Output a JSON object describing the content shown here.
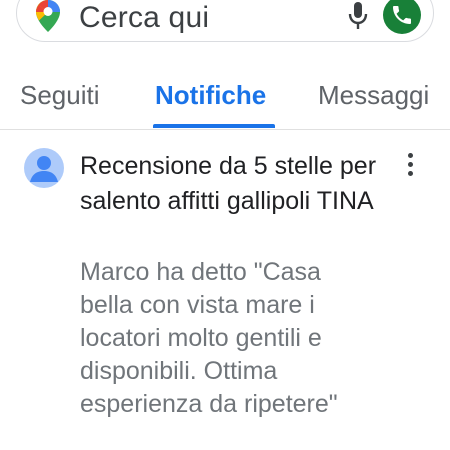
{
  "search": {
    "placeholder": "Cerca qui",
    "maps_icon": "google-maps-pin-icon",
    "mic_icon": "microphone-icon",
    "call_icon": "phone-icon"
  },
  "tabs": [
    {
      "label": "Seguiti",
      "active": false
    },
    {
      "label": "Notifiche",
      "active": true
    },
    {
      "label": "Messaggi",
      "active": false
    }
  ],
  "notification": {
    "avatar_icon": "person-avatar-icon",
    "title": "Recensione da 5 stelle per salento affitti gallipoli TINA",
    "body": "Marco ha detto \"Casa bella con vista mare i locatori molto gentili e disponibili. Ottima esperienza da ripetere\"",
    "menu_icon": "more-vert-icon"
  },
  "colors": {
    "accent": "#1a73e8",
    "call_green": "#188038",
    "secondary_text": "#70757a",
    "avatar_bg": "#aecbfa",
    "avatar_fg": "#4285f4"
  }
}
